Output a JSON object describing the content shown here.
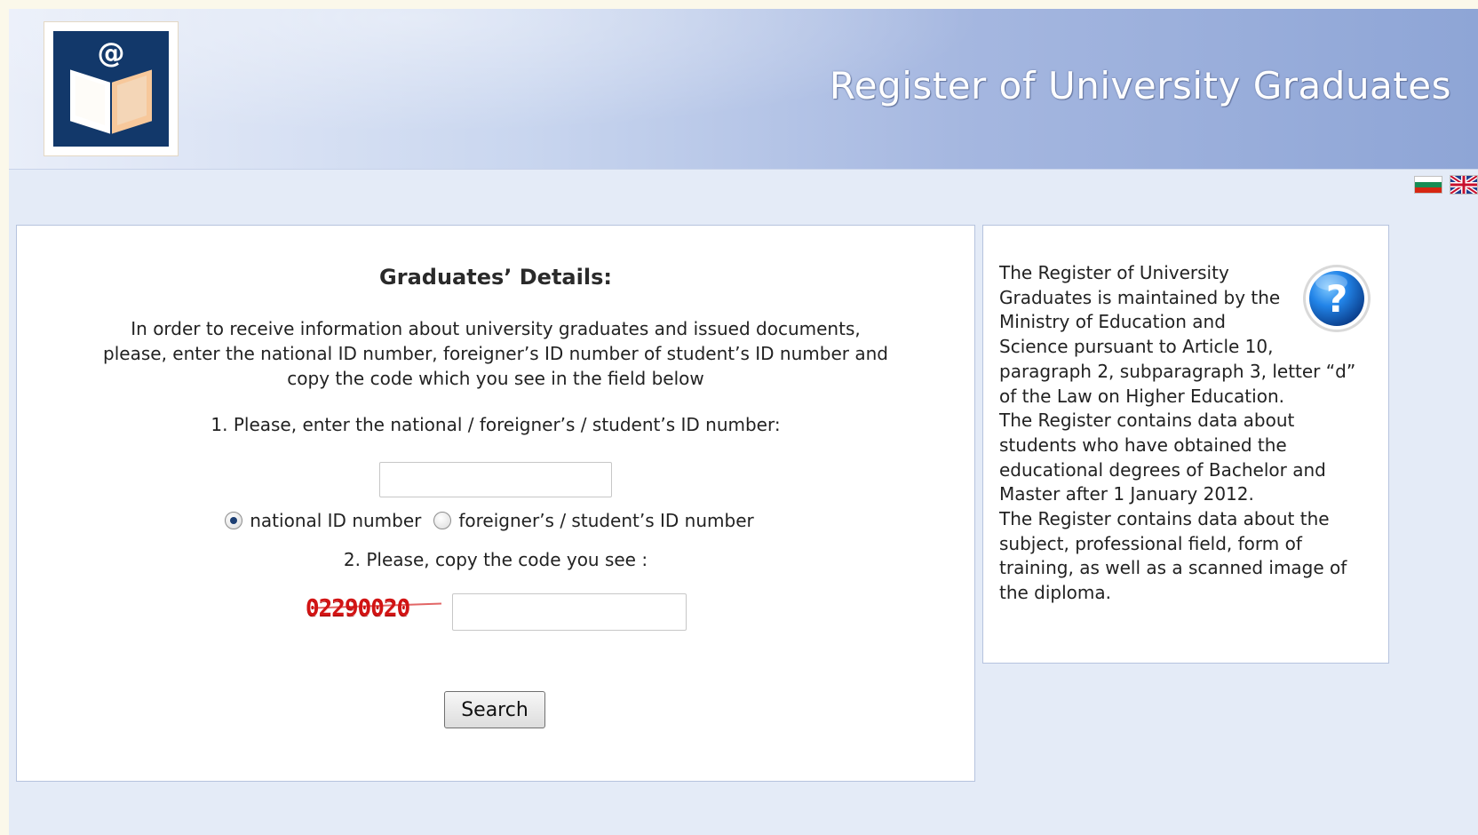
{
  "header": {
    "title": "Register of University Graduates",
    "logo_name": "register-logo",
    "accent": "#12386a"
  },
  "language": {
    "bulgarian": "bg-flag-icon",
    "english": "gb-flag-icon"
  },
  "form": {
    "title": "Graduates’ Details:",
    "instructions": "In order to receive information about university graduates and issued documents, please, enter the national ID number, foreigner’s ID number of student’s ID number and copy the code which you see in the field below",
    "step1_label": "1. Please, enter the national / foreigner’s / student’s ID number:",
    "id_value": "",
    "id_placeholder": "",
    "radio_national": "national ID number",
    "radio_foreign": "foreigner’s / student’s ID number",
    "selected_radio": "national",
    "step2_label": "2. Please, copy the code you see :",
    "captcha_code": "02290020",
    "code_value": "",
    "code_placeholder": "",
    "search_label": "Search"
  },
  "info": {
    "help_icon": "question-icon",
    "paragraphs": [
      "The Register of University Graduates is maintained by the Ministry of Education and Science pursuant to Article 10, paragraph 2, subparagraph 3, letter “d” of the Law on Higher Education.",
      "The Register contains data about students who have obtained the educational degrees of Bachelor and Master after 1 January 2012.",
      "The Register contains data about the subject, professional field, form of training, as well as a scanned image of the diploma."
    ]
  },
  "colors": {
    "captcha": "#d21414",
    "panel_border": "#b6c3de",
    "background": "#e4ebf7"
  }
}
